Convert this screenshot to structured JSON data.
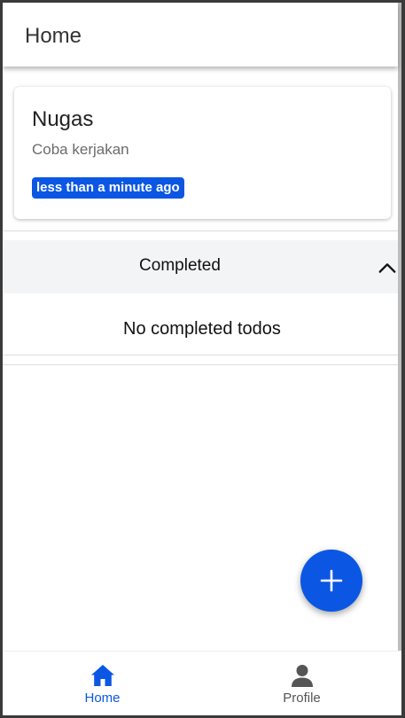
{
  "appbar": {
    "title": "Home"
  },
  "todos": [
    {
      "title": "Nugas",
      "description": "Coba kerjakan",
      "time": "less than a minute ago"
    }
  ],
  "completed": {
    "label": "Completed",
    "expanded": true,
    "empty_text": "No completed todos"
  },
  "fab": {
    "icon": "plus-icon"
  },
  "bottom_nav": {
    "items": [
      {
        "label": "Home",
        "icon": "home-icon",
        "active": true
      },
      {
        "label": "Profile",
        "icon": "person-icon",
        "active": false
      }
    ]
  },
  "colors": {
    "accent": "#0b57e3",
    "inactive": "#555555",
    "section_bg": "#f3f4f6"
  }
}
